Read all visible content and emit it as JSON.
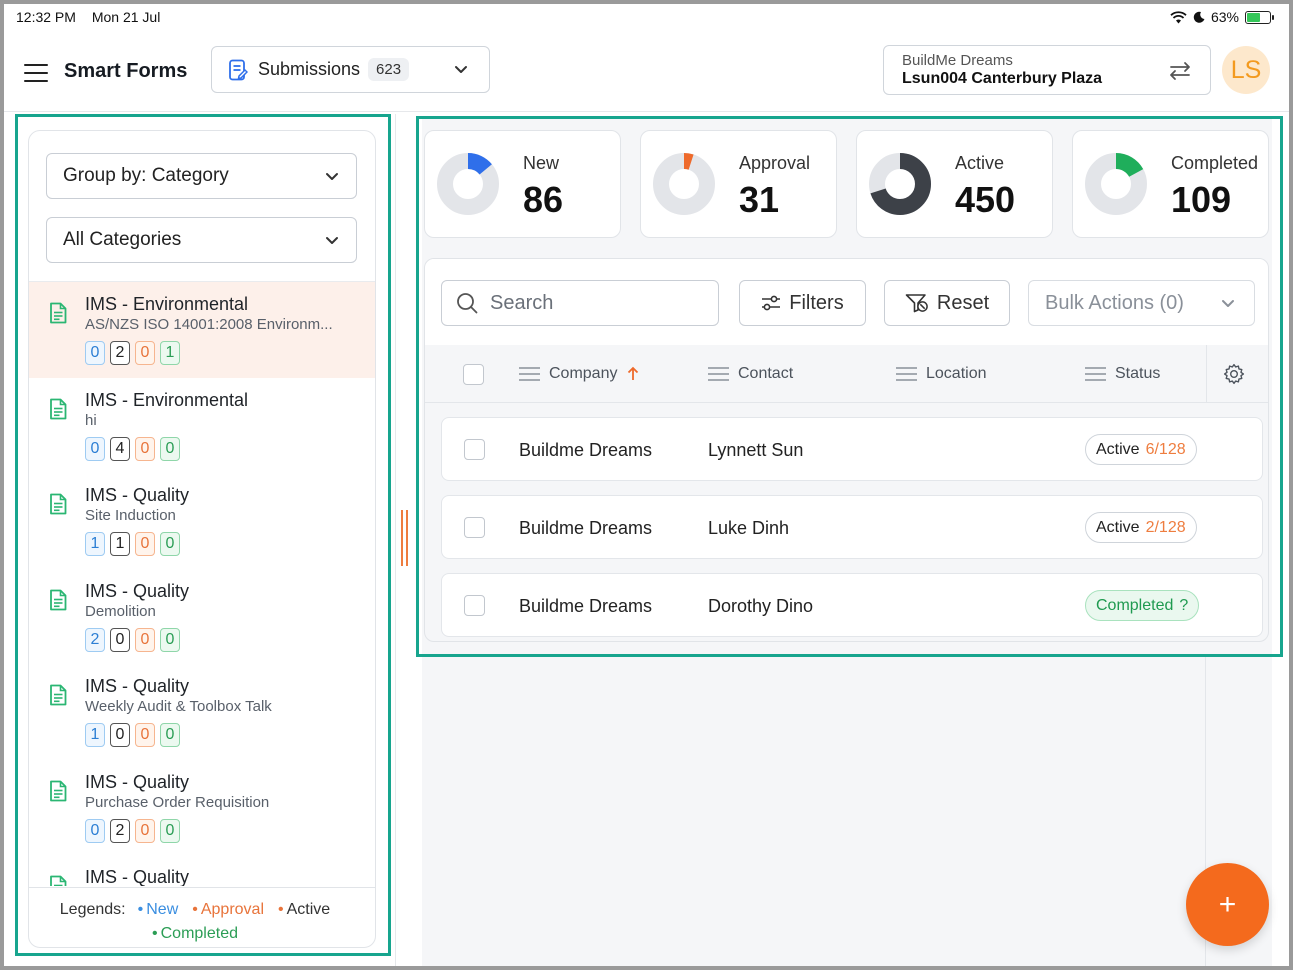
{
  "status_bar": {
    "time": "12:32 PM",
    "date": "Mon 21 Jul",
    "battery": "63%",
    "battery_level": 0.63
  },
  "header": {
    "app_title": "Smart Forms",
    "view_selector": {
      "label": "Submissions",
      "count": "623"
    },
    "project": {
      "org": "BuildMe Dreams",
      "name": "Lsun004 Canterbury Plaza"
    },
    "avatar_initials": "LS"
  },
  "sidebar": {
    "group_by": "Group by: Category",
    "category_filter": "All Categories",
    "items": [
      {
        "title": "IMS - Environmental",
        "subtitle": "AS/NZS ISO 14001:2008 Environm...",
        "counts": [
          "0",
          "2",
          "0",
          "1"
        ],
        "selected": true
      },
      {
        "title": "IMS - Environmental",
        "subtitle": "hi",
        "counts": [
          "0",
          "4",
          "0",
          "0"
        ]
      },
      {
        "title": "IMS - Quality",
        "subtitle": "Site Induction",
        "counts": [
          "1",
          "1",
          "0",
          "0"
        ]
      },
      {
        "title": "IMS - Quality",
        "subtitle": "Demolition",
        "counts": [
          "2",
          "0",
          "0",
          "0"
        ]
      },
      {
        "title": "IMS - Quality",
        "subtitle": "Weekly Audit & Toolbox Talk",
        "counts": [
          "1",
          "0",
          "0",
          "0"
        ]
      },
      {
        "title": "IMS - Quality",
        "subtitle": "Purchase Order Requisition",
        "counts": [
          "0",
          "2",
          "0",
          "0"
        ]
      },
      {
        "title": "IMS - Quality",
        "subtitle": "",
        "counts": []
      }
    ],
    "legend": {
      "label": "Legends:",
      "new": "New",
      "approval": "Approval",
      "active": "Active",
      "completed": "Completed"
    }
  },
  "stats": [
    {
      "label": "New",
      "value": "86",
      "color": "#2f6fea",
      "fraction": 0.14
    },
    {
      "label": "Approval",
      "value": "31",
      "color": "#ee6a2b",
      "fraction": 0.05
    },
    {
      "label": "Active",
      "value": "450",
      "color": "#3d4148",
      "fraction": 0.7
    },
    {
      "label": "Completed",
      "value": "109",
      "color": "#1fae5b",
      "fraction": 0.17
    }
  ],
  "toolbar": {
    "search_placeholder": "Search",
    "filters_label": "Filters",
    "reset_label": "Reset",
    "bulk_actions_label": "Bulk Actions (0)"
  },
  "table": {
    "columns": [
      "Company",
      "Contact",
      "Location",
      "Status"
    ],
    "sort": {
      "column": "Company",
      "direction": "asc"
    },
    "rows": [
      {
        "company": "Buildme Dreams",
        "contact": "Lynnett Sun",
        "location": "",
        "status": "Active",
        "progress": "6/128"
      },
      {
        "company": "Buildme Dreams",
        "contact": "Luke Dinh",
        "location": "",
        "status": "Active",
        "progress": "2/128"
      },
      {
        "company": "Buildme Dreams",
        "contact": "Dorothy Dino",
        "location": "",
        "status": "Completed",
        "progress": "?"
      }
    ]
  },
  "fab_label": "+",
  "colors": {
    "accent": "#f46a1d",
    "highlight_outline": "#17a58e",
    "new": "#2f6fea",
    "approval": "#ee6a2b",
    "completed": "#1fae5b"
  }
}
